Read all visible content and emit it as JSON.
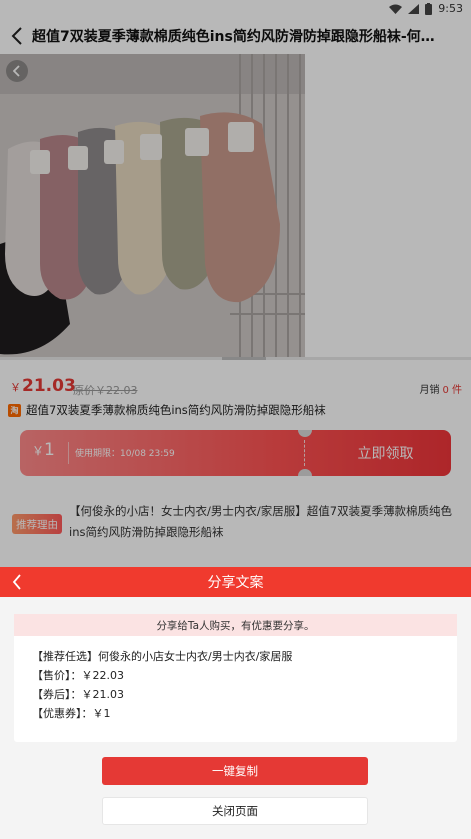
{
  "status_bar": {
    "time": "9:53",
    "icons": [
      "wifi-icon",
      "signal-icon",
      "battery-icon"
    ]
  },
  "header": {
    "title": "超值7双装夏季薄款棉质纯色ins简约风防滑防掉跟隐形船袜-何俊永的..."
  },
  "product": {
    "price_currency": "￥",
    "price_now": "21.03",
    "price_original": "原价￥22.03",
    "monthly_label": "月销",
    "monthly_count": "0 件",
    "platform_badge": "淘",
    "title": "超值7双装夏季薄款棉质纯色ins简约风防滑防掉跟隐形船袜"
  },
  "coupon": {
    "currency": "￥",
    "amount": "1",
    "expire": "使用期限：10/08 23:59",
    "button": "立即领取"
  },
  "recommend": {
    "tag": "推荐理由",
    "text": "【何俊永的小店！女士内衣/男士内衣/家居服】超值7双装夏季薄款棉质纯色ins简约风防滑防掉跟隐形船袜"
  },
  "share": {
    "title": "分享文案",
    "notice": "分享给Ta人购买，有优惠要分享。",
    "lines": [
      "【推荐任选】何俊永的小店女士内衣/男士内衣/家居服",
      "【售价】：￥22.03",
      "【券后】：￥21.03",
      "【优惠券】：￥1"
    ],
    "copy_button": "一键复制",
    "close_button": "关闭页面"
  },
  "colors": {
    "accent": "#e53935",
    "header_red": "#f03a2e",
    "notice_bg": "#fbe3e3"
  }
}
